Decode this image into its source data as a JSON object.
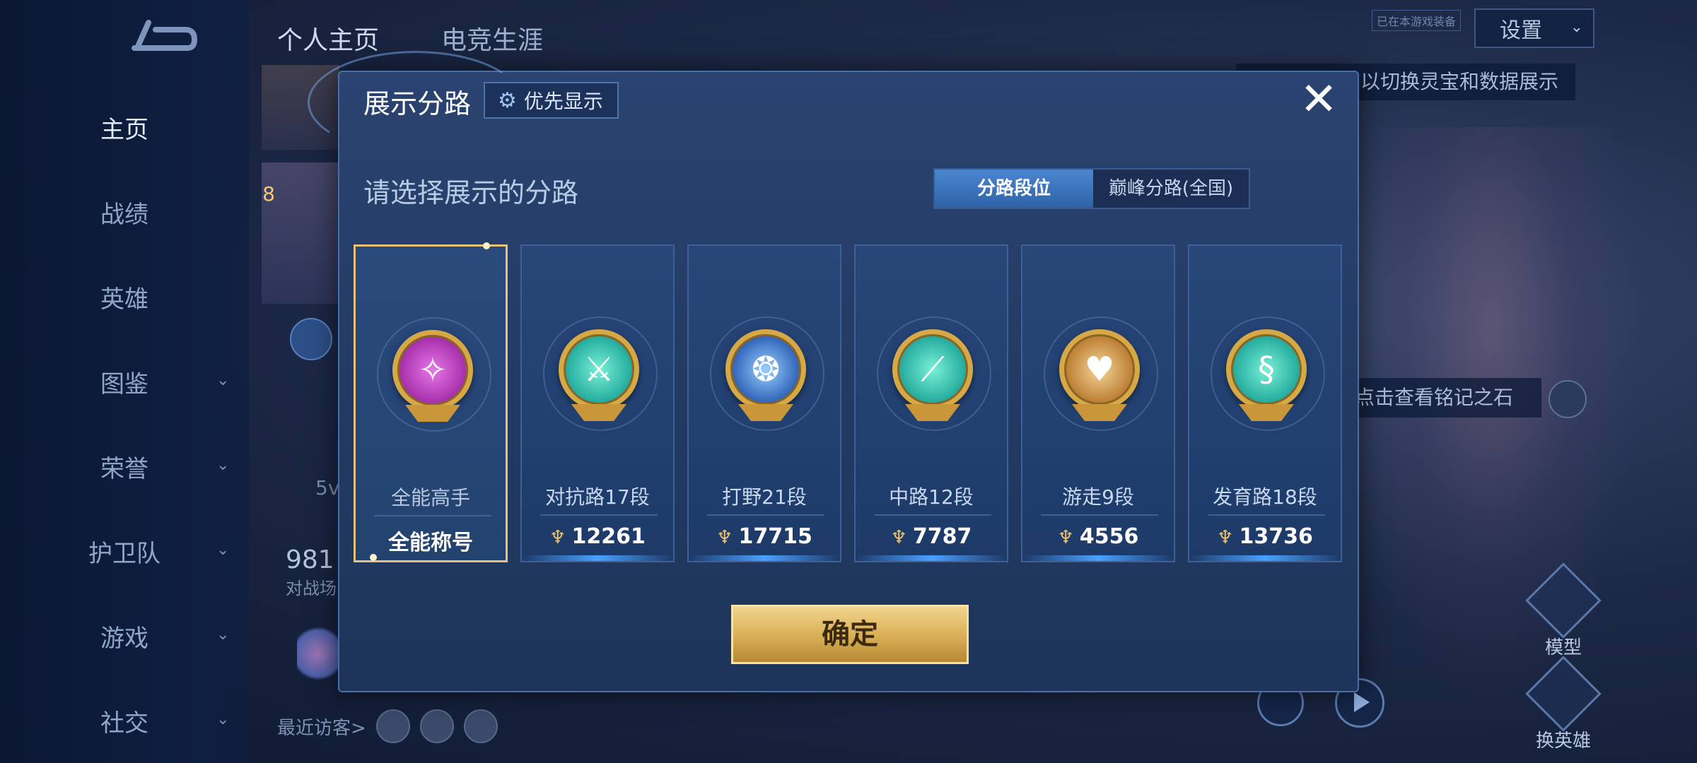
{
  "sidebar": {
    "items": [
      {
        "label": "主页",
        "has_chevron": false
      },
      {
        "label": "战绩",
        "has_chevron": false
      },
      {
        "label": "英雄",
        "has_chevron": false
      },
      {
        "label": "图鉴",
        "has_chevron": true
      },
      {
        "label": "荣誉",
        "has_chevron": true
      },
      {
        "label": "护卫队",
        "has_chevron": true
      },
      {
        "label": "游戏",
        "has_chevron": true
      },
      {
        "label": "社交",
        "has_chevron": true
      }
    ]
  },
  "header": {
    "tabs": [
      "个人主页",
      "电竞生涯"
    ],
    "settings_label": "设置",
    "small_badge": "已在本游戏装备"
  },
  "background": {
    "hint_top": "以切换灵宝和数据展示",
    "hint_mid": "点击查看铭记之石",
    "level": "8",
    "stat_value": "981",
    "stat_label": "对战场",
    "mode_text": "5v",
    "recent_visitors": "最近访客>",
    "side_actions": [
      "模型",
      "换英雄"
    ]
  },
  "modal": {
    "title": "展示分路",
    "priority_label": "优先显示",
    "close_symbol": "✕",
    "subtitle": "请选择展示的分路",
    "segment": {
      "active": "分路段位",
      "inactive": "巅峰分路(全国)"
    },
    "lanes": [
      {
        "name": "全能高手",
        "value": "全能称号",
        "points_icon": false,
        "badge_color": "purple",
        "selected": true
      },
      {
        "name": "对抗路17段",
        "value": "12261",
        "points_icon": true,
        "badge_color": "teal",
        "selected": false
      },
      {
        "name": "打野21段",
        "value": "17715",
        "points_icon": true,
        "badge_color": "blue",
        "selected": false
      },
      {
        "name": "中路12段",
        "value": "7787",
        "points_icon": true,
        "badge_color": "teal",
        "selected": false
      },
      {
        "name": "游走9段",
        "value": "4556",
        "points_icon": true,
        "badge_color": "gold",
        "selected": false
      },
      {
        "name": "发育路18段",
        "value": "13736",
        "points_icon": true,
        "badge_color": "teal",
        "selected": false
      }
    ],
    "confirm_label": "确定"
  },
  "colors": {
    "accent_gold": "#e8c27a",
    "modal_bg": "#223a63",
    "segment_active": "#3f78c4"
  }
}
